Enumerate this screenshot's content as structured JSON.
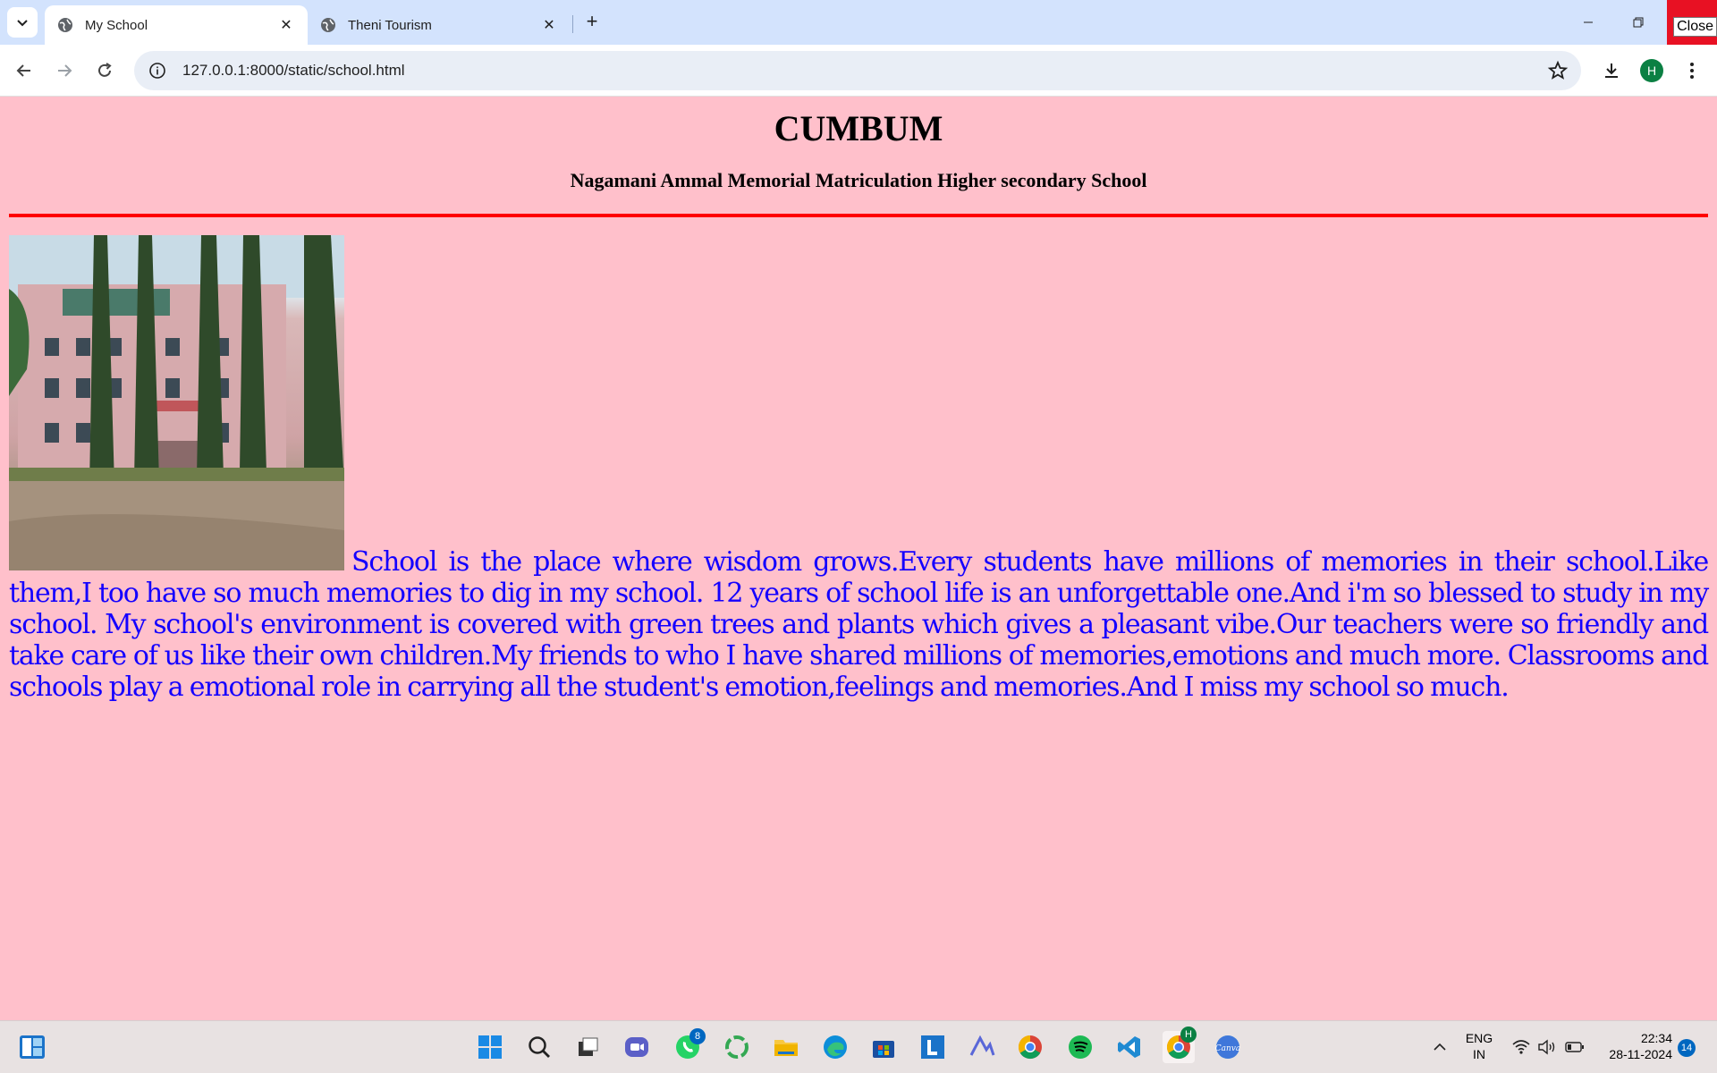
{
  "browser": {
    "tabs": [
      {
        "title": "My School",
        "active": true
      },
      {
        "title": "Theni Tourism",
        "active": false
      }
    ],
    "close_tooltip": "Close",
    "url": "127.0.0.1:8000/static/school.html",
    "profile_initial": "H"
  },
  "page": {
    "heading": "CUMBUM",
    "subheading": "Nagamani Ammal Memorial Matriculation Higher secondary School",
    "paragraph": "School is the place where wisdom grows.Every students have millions of memories in their school.Like them,I too have so much memories to dig in my school. 12 years of school life is an unforgettable one.And i'm so blessed to study in my school. My school's environment is covered with green trees and plants which gives a pleasant vibe.Our teachers were so friendly and take care of us like their own children.My friends to who I have shared millions of memories,emotions and much more. Classrooms and schools play a emotional role in carrying all the student's emotion,feelings and memories.And I miss my school so much.",
    "colors": {
      "background": "#ffc0cb",
      "rule": "#ff0000",
      "paragraph": "#1400ff"
    }
  },
  "taskbar": {
    "whatsapp_badge": "8",
    "chrome_profile_badge": "H",
    "language_line1": "ENG",
    "language_line2": "IN",
    "time": "22:34",
    "date": "28-11-2024",
    "notification_count": "14",
    "apps": [
      "widgets-icon",
      "windows-start-icon",
      "search-icon",
      "task-view-icon",
      "teams-icon",
      "whatsapp-icon",
      "copilot-icon",
      "file-explorer-icon",
      "edge-icon",
      "microsoft-store-icon",
      "lens-app-icon",
      "arc-icon",
      "chrome-icon",
      "spotify-icon",
      "vscode-icon",
      "chrome-profile-icon",
      "canva-icon"
    ]
  }
}
